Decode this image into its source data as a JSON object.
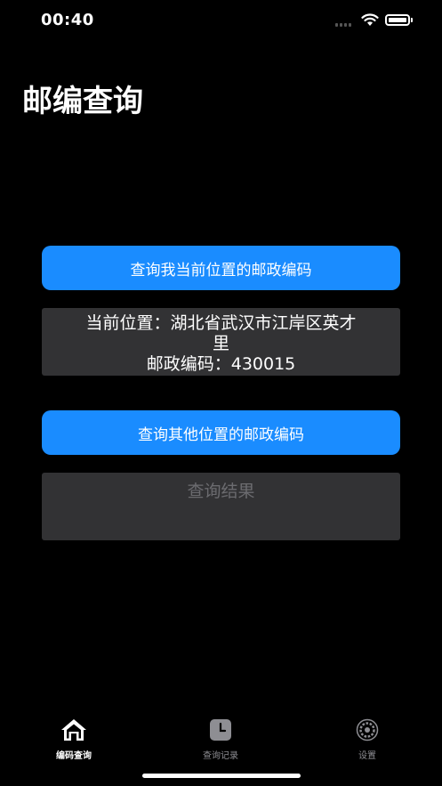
{
  "status_bar": {
    "time": "00:40"
  },
  "page": {
    "title": "邮编查询"
  },
  "actions": {
    "current_location_button": "查询我当前位置的邮政编码",
    "other_location_button": "查询其他位置的邮政编码"
  },
  "current_info": {
    "location_line_1": "当前位置：湖北省武汉市江岸区英才",
    "location_line_2": "里",
    "postcode_line": "邮政编码：430015"
  },
  "result": {
    "placeholder": "查询结果"
  },
  "tab_bar": {
    "tabs": [
      {
        "label": "编码查询",
        "icon": "house-icon",
        "active": true
      },
      {
        "label": "查询记录",
        "icon": "clock-icon",
        "active": false
      },
      {
        "label": "设置",
        "icon": "gear-icon",
        "active": false
      }
    ]
  }
}
